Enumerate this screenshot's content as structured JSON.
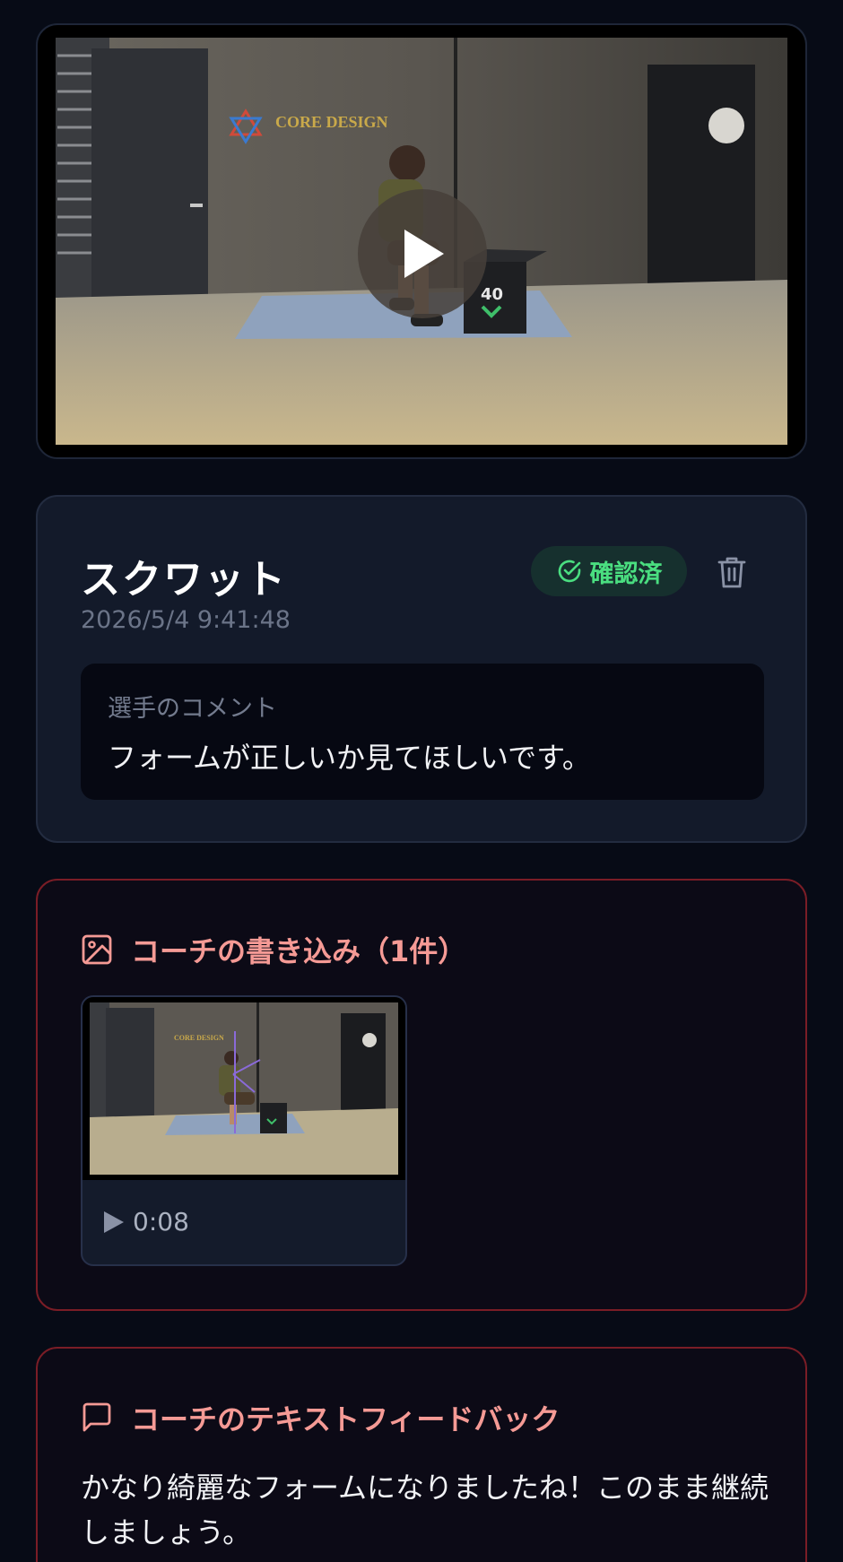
{
  "video": {
    "wall_logo": "CORE DESIGN",
    "play_icon": "play-icon",
    "box_label": "40"
  },
  "exercise": {
    "title": "スクワット",
    "timestamp": "2026/5/4 9:41:48",
    "status_label": "確認済",
    "status_icon": "check-circle-icon",
    "delete_icon": "trash-icon"
  },
  "athlete_comment": {
    "label": "選手のコメント",
    "text": "フォームが正しいか見てほしいです。"
  },
  "coach_annotations": {
    "header": "コーチの書き込み（1件）",
    "header_icon": "image-icon",
    "items": [
      {
        "duration": "0:08",
        "play_icon": "play-icon"
      }
    ]
  },
  "coach_feedback": {
    "header": "コーチのテキストフィードバック",
    "header_icon": "message-square-icon",
    "text": "かなり綺麗なフォームになりましたね！このまま継続しましょう。"
  },
  "colors": {
    "background": "#070b16",
    "card": "#131a2a",
    "accent_red": "#f59a95",
    "accent_border": "#7a1d26",
    "status_green": "#4ade80"
  }
}
